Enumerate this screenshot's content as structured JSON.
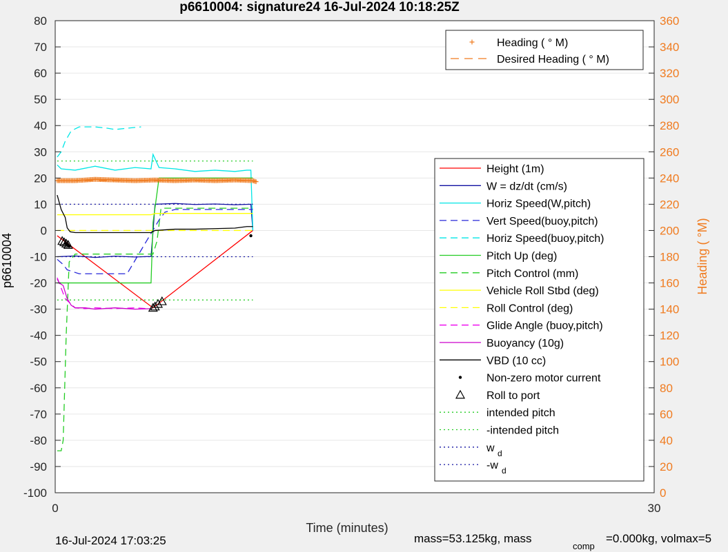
{
  "chart_data": {
    "type": "line",
    "title": "p6610004: signature24 16-Jul-2024 10:18:25Z",
    "xlabel": "Time (minutes)",
    "ylabel": "p6610004",
    "y2label": "Heading ( °M)",
    "xlim": [
      0,
      30
    ],
    "ylim": [
      -100,
      80
    ],
    "y2lim": [
      0,
      360
    ],
    "x_ticks": [
      0,
      30
    ],
    "y_ticks": [
      80,
      70,
      60,
      50,
      40,
      30,
      20,
      10,
      0,
      -10,
      -20,
      -30,
      -40,
      -50,
      -60,
      -70,
      -80,
      -90,
      -100
    ],
    "y2_ticks": [
      360,
      340,
      320,
      300,
      280,
      260,
      240,
      220,
      200,
      180,
      160,
      140,
      120,
      100,
      80,
      60,
      40,
      20,
      0
    ],
    "grid": "horizontal",
    "colors": {
      "axis2": "#f07b1f",
      "height": "#ff0000",
      "w": "#1010a0",
      "horiz": "#00e6e6",
      "vert_buoy": "#2626d9",
      "pitch": "#22cc22",
      "roll": "#ffff00",
      "glide": "#ee00ee",
      "buoyancy": "#cc00cc",
      "vbd": "#000000",
      "heading": "#f07b1f"
    },
    "legend_heading": {
      "position": "top-right",
      "entries": [
        "Heading (  ° M)",
        "Desired Heading (    ° M)"
      ]
    },
    "legend_main": {
      "position": "right",
      "entries": [
        "Height (1m)",
        "W = dz/dt (cm/s)",
        "Horiz Speed(W,pitch)",
        "Vert Speed(buoy,pitch)",
        "Horiz Speed(buoy,pitch)",
        "Pitch Up (deg)",
        "Pitch Control (mm)",
        "Vehicle Roll Stbd (deg)",
        "Roll Control (deg)",
        "Glide Angle (buoy,pitch)",
        "Buoyancy (10g)",
        "VBD (10 cc)",
        "Non-zero motor current",
        "Roll to port",
        "intended pitch",
        "-intended pitch",
        "w",
        "-w"
      ],
      "subscript": "d"
    },
    "series": [
      {
        "name": "Height (1m)",
        "x": [
          0.1,
          4.9,
          9.9
        ],
        "y": [
          -2,
          -29.5,
          0
        ]
      },
      {
        "name": "W = dz/dt (cm/s)",
        "x": [
          0.1,
          1.0,
          2.0,
          3.0,
          4.0,
          4.8,
          4.9,
          5.0,
          6.0,
          7.0,
          8.0,
          9.0,
          9.8,
          9.9
        ],
        "y": [
          -10,
          -9.7,
          -10.3,
          -9.8,
          -10.1,
          -9.9,
          -0.5,
          10,
          10.3,
          9.9,
          10.1,
          9.8,
          10,
          0
        ]
      },
      {
        "name": "Horiz Speed(W,pitch)",
        "x": [
          0.1,
          0.3,
          1.0,
          2.0,
          3.0,
          4.0,
          4.8,
          4.9,
          5.2,
          6.0,
          7.0,
          8.0,
          9.0,
          9.6,
          9.8,
          9.9
        ],
        "y": [
          25,
          23.5,
          23,
          24.5,
          23,
          24,
          23.5,
          29,
          24,
          23.5,
          22.5,
          23,
          22.5,
          23,
          23,
          0
        ]
      },
      {
        "name": "Vert Speed(buoy,pitch)",
        "x": [
          0.1,
          0.4,
          0.6,
          1.2,
          2.0,
          3.0,
          3.6,
          5.2,
          5.5,
          6.0,
          7.0,
          8.0,
          9.0,
          9.9
        ],
        "y": [
          -11,
          -13,
          -15,
          -16.5,
          -16.5,
          -16.5,
          -16.5,
          4,
          7,
          8,
          8,
          8,
          8,
          8
        ]
      },
      {
        "name": "Horiz Speed(buoy,pitch)",
        "x": [
          0.1,
          0.3,
          0.5,
          0.8,
          1.2,
          2.0,
          2.6,
          3.0,
          3.6,
          4.3
        ],
        "y": [
          28,
          30,
          34,
          38,
          39.5,
          39.5,
          39,
          38.5,
          39,
          39.5
        ]
      },
      {
        "name": "Pitch Up (deg)",
        "x": [
          0.1,
          4.8,
          4.9,
          5.2,
          6.0,
          7.0,
          8.0,
          9.0,
          9.9
        ],
        "y": [
          -20,
          -20,
          3,
          20,
          20,
          20,
          20,
          20,
          20
        ]
      },
      {
        "name": "Pitch Control (mm)",
        "x": [
          0.1,
          0.3,
          0.4,
          0.55,
          0.7,
          1.0,
          4.7,
          4.9,
          5.1,
          5.3,
          9.9
        ],
        "y": [
          -84,
          -84,
          -80,
          -40,
          -12,
          -9,
          -9,
          -9,
          -4,
          8.5,
          8.5
        ]
      },
      {
        "name": "Vehicle Roll Stbd (deg)",
        "x": [
          0.1,
          4.8,
          5.0,
          9.9
        ],
        "y": [
          6,
          6,
          6.5,
          6.5
        ]
      },
      {
        "name": "Roll Control (deg)",
        "x": [
          0.1,
          9.9
        ],
        "y": [
          0,
          0
        ]
      },
      {
        "name": "Glide Angle (buoy,pitch)",
        "x": [
          0.1,
          0.3,
          0.5,
          1.0,
          1.5,
          2.0,
          3.0,
          4.0,
          4.6
        ],
        "y": [
          -18,
          -22,
          -26,
          -29.5,
          -29.8,
          -29.5,
          -29.8,
          -29.5,
          -29.8
        ]
      },
      {
        "name": "Buoyancy (10g)",
        "x": [
          0.1,
          0.2,
          0.4,
          0.6,
          0.8,
          1.0,
          1.5,
          2.0,
          3.0,
          4.0,
          4.8
        ],
        "y": [
          -18.5,
          -20,
          -21,
          -26,
          -28.5,
          -29.5,
          -29.5,
          -30,
          -29.5,
          -30,
          -29.8
        ]
      },
      {
        "name": "VBD (10 cc)",
        "x": [
          0.1,
          0.3,
          0.5,
          0.6,
          0.75,
          1.0,
          2.0,
          3.0,
          4.0,
          4.8,
          5.0,
          6.0,
          7.0,
          8.0,
          9.0,
          9.6,
          9.9
        ],
        "y": [
          13.5,
          8,
          5,
          1,
          -0.5,
          -0.8,
          -0.8,
          -0.8,
          -0.8,
          -0.8,
          0,
          0.5,
          0.5,
          0.7,
          0.9,
          1.5,
          1.5
        ]
      },
      {
        "name": "Non-zero motor current",
        "x": [
          0.5,
          0.6,
          0.7,
          9.8
        ],
        "y": [
          -5,
          -5.5,
          -6,
          -2
        ]
      },
      {
        "name": "Roll to port",
        "x": [
          0.35,
          0.45,
          0.55,
          0.65,
          4.9,
          5.0,
          5.15,
          5.35
        ],
        "y": [
          -4,
          -4.5,
          -5,
          -5.5,
          -29.5,
          -29,
          -28,
          -27
        ]
      },
      {
        "name": "intended pitch",
        "x": [
          0.1,
          9.9
        ],
        "y": [
          26.5,
          26.5
        ]
      },
      {
        "name": "-intended pitch",
        "x": [
          0.1,
          9.9
        ],
        "y": [
          -26.5,
          -26.5
        ]
      },
      {
        "name": "w",
        "x": [
          0.1,
          9.9
        ],
        "y": [
          10,
          10
        ]
      },
      {
        "name": "-w",
        "x": [
          0.1,
          9.9
        ],
        "y": [
          -10,
          -10
        ]
      },
      {
        "name": "Heading ( ° M)",
        "axis": "right",
        "x": [
          0.1,
          1.0,
          2.0,
          3.0,
          4.0,
          5.0,
          6.0,
          7.0,
          8.0,
          9.0,
          9.9,
          10.1
        ],
        "y": [
          238,
          238,
          239,
          238.5,
          238,
          238.5,
          238,
          238.5,
          238,
          238.5,
          238,
          237
        ]
      },
      {
        "name": "Desired Heading ( ° M)",
        "axis": "right",
        "x": [
          0.1,
          9.9
        ],
        "y": [
          238,
          238
        ]
      }
    ]
  },
  "footer": {
    "timestamp": "16-Jul-2024 17:03:25",
    "mass_prefix": "mass=53.125kg, mass",
    "mass_sub": "comp",
    "mass_suffix": "=0.000kg, volmax=5"
  }
}
